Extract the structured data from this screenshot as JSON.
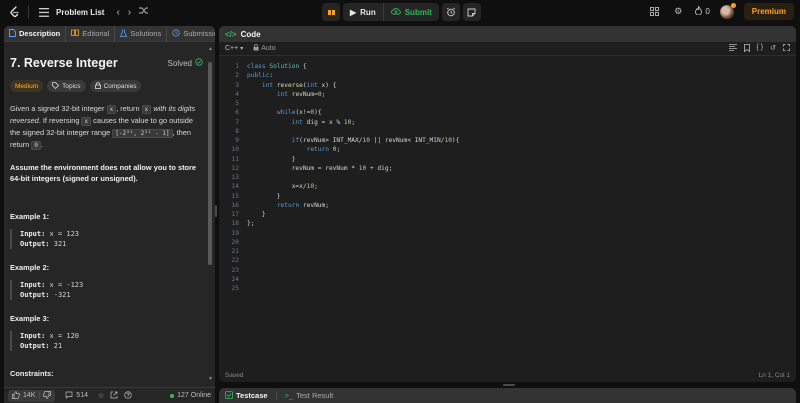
{
  "topbar": {
    "problem_list_label": "Problem List",
    "run_label": "Run",
    "submit_label": "Submit",
    "streak_count": "0",
    "premium_label": "Premium",
    "colors": {
      "accent_orange": "#ffa116",
      "accent_green": "#2cbb5d"
    }
  },
  "left_panel": {
    "tabs": [
      {
        "label": "Description",
        "icon": "document-icon",
        "active": true
      },
      {
        "label": "Editorial",
        "icon": "book-icon"
      },
      {
        "label": "Solutions",
        "icon": "flask-icon"
      },
      {
        "label": "Submission",
        "icon": "history-icon"
      }
    ],
    "title": "7. Reverse Integer",
    "solved_label": "Solved",
    "tags": {
      "difficulty": "Medium",
      "topics": "Topics",
      "companies": "Companies"
    },
    "description": {
      "p1_a": "Given a signed 32-bit integer ",
      "p1_code_x": "x",
      "p1_b": ", return ",
      "p1_code_x2": "x",
      "p1_em": " with its digits reversed",
      "p1_c": ". If reversing ",
      "p1_code_x3": "x",
      "p1_d": " causes the value to go outside the signed 32-bit integer range ",
      "p1_code_range": "[-2³¹, 2³¹ - 1]",
      "p1_e": ", then return ",
      "p1_code_zero": "0",
      "p1_f": ".",
      "p2": "Assume the environment does not allow you to store 64-bit integers (signed or unsigned)."
    },
    "examples": [
      {
        "title": "Example 1:",
        "input_label": "Input:",
        "input": "x = 123",
        "output_label": "Output:",
        "output": "321"
      },
      {
        "title": "Example 2:",
        "input_label": "Input:",
        "input": "x = -123",
        "output_label": "Output:",
        "output": "-321"
      },
      {
        "title": "Example 3:",
        "input_label": "Input:",
        "input": "x = 120",
        "output_label": "Output:",
        "output": "21"
      }
    ],
    "constraints_label": "Constraints:",
    "bottom": {
      "likes": "14K",
      "comments": "514",
      "online": "127 Online"
    }
  },
  "code_panel": {
    "title": "Code",
    "language": "C++",
    "auto_label": "Auto",
    "lines": [
      "class Solution {",
      "public:",
      "    int reverse(int x) {",
      "        int revNum=0;",
      "",
      "        while(x!=0){",
      "            int dig = x % 10;",
      "",
      "            if(revNum> INT_MAX/10 || revNum< INT_MIN/10){",
      "                return 0;",
      "            }",
      "            revNum = revNum * 10 + dig;",
      "",
      "            x=x/10;",
      "        }",
      "        return revNum;",
      "    }",
      "};",
      "",
      "",
      "",
      "",
      "",
      "",
      ""
    ],
    "status": "Saved",
    "cursor": "Ln 1, Col 1"
  },
  "test_panel": {
    "tabs": [
      {
        "label": "Testcase",
        "active": true
      },
      {
        "label": "Test Result"
      }
    ]
  }
}
